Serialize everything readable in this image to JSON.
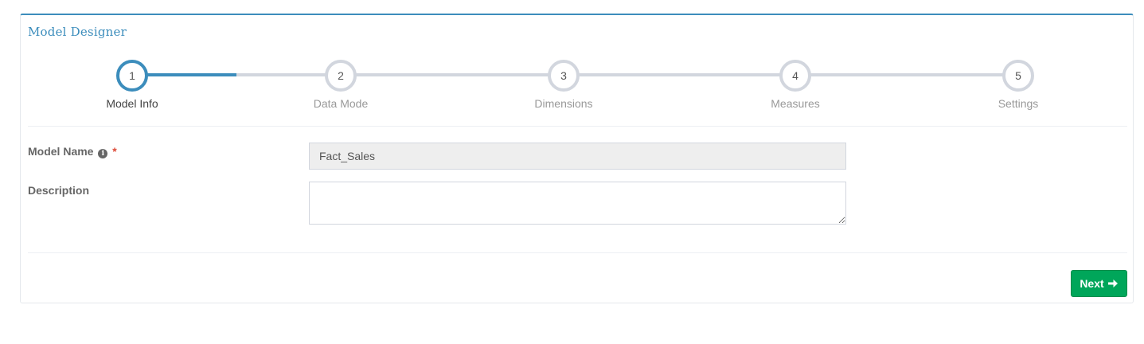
{
  "panel": {
    "title": "Model Designer"
  },
  "stepper": {
    "current_step": 1,
    "steps": [
      {
        "number": "1",
        "label": "Model Info",
        "state": "active"
      },
      {
        "number": "2",
        "label": "Data Mode",
        "state": "pending"
      },
      {
        "number": "3",
        "label": "Dimensions",
        "state": "pending"
      },
      {
        "number": "4",
        "label": "Measures",
        "state": "pending"
      },
      {
        "number": "5",
        "label": "Settings",
        "state": "pending"
      }
    ]
  },
  "form": {
    "model_name": {
      "label": "Model Name",
      "required_marker": "*",
      "info_icon": "info-circle-icon",
      "value": "Fact_Sales",
      "readonly": true
    },
    "description": {
      "label": "Description",
      "value": ""
    }
  },
  "footer": {
    "next_label": "Next",
    "next_icon": "arrow-right-icon"
  },
  "colors": {
    "accent": "#3c8dbc",
    "inactive_step": "#d2d6de",
    "required": "#dd4b39",
    "success_button": "#00a65a"
  }
}
